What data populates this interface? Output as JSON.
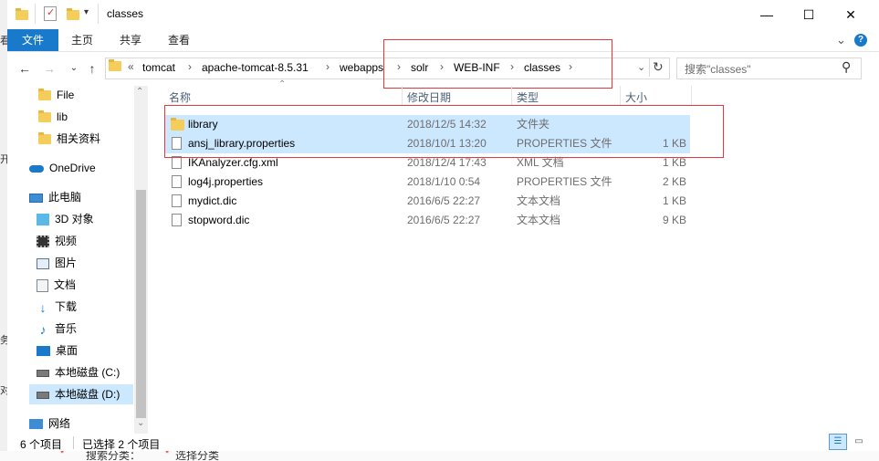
{
  "window": {
    "title": "classes",
    "minimize_glyph": "—",
    "maximize_glyph": "☐",
    "close_glyph": "✕"
  },
  "ribbon": {
    "tabs": [
      "文件",
      "主页",
      "共享",
      "查看"
    ],
    "expand_glyph": "⌄",
    "help_glyph": "?"
  },
  "nav_buttons": {
    "back": "←",
    "forward": "→",
    "recent": "⌄",
    "up": "↑"
  },
  "address": {
    "overflow": "«",
    "crumbs": [
      "tomcat",
      "apache-tomcat-8.5.31",
      "webapps",
      "solr",
      "WEB-INF",
      "classes"
    ],
    "separator": "›",
    "dropdown_glyph": "⌄",
    "refresh_glyph": "↻"
  },
  "search": {
    "placeholder": "搜索\"classes\"",
    "icon": "search-icon",
    "glyph": "⚲"
  },
  "sidebar": {
    "items": [
      {
        "label": "File",
        "icon": "folder-icon"
      },
      {
        "label": "lib",
        "icon": "folder-icon"
      },
      {
        "label": "相关资料",
        "icon": "folder-icon"
      },
      {
        "label": "OneDrive",
        "icon": "cloud-icon"
      },
      {
        "label": "此电脑",
        "icon": "computer-icon"
      },
      {
        "label": "3D 对象",
        "icon": "3d-objects-icon"
      },
      {
        "label": "视频",
        "icon": "video-icon"
      },
      {
        "label": "图片",
        "icon": "pictures-icon"
      },
      {
        "label": "文档",
        "icon": "documents-icon"
      },
      {
        "label": "下载",
        "icon": "download-icon"
      },
      {
        "label": "音乐",
        "icon": "music-icon"
      },
      {
        "label": "桌面",
        "icon": "desktop-icon"
      },
      {
        "label": "本地磁盘 (C:)",
        "icon": "drive-icon"
      },
      {
        "label": "本地磁盘 (D:)",
        "icon": "drive-icon"
      },
      {
        "label": "网络",
        "icon": "network-icon"
      }
    ],
    "scroll_up": "⌃",
    "scroll_down": "⌄"
  },
  "columns": {
    "name": "名称",
    "date": "修改日期",
    "type": "类型",
    "size": "大小",
    "sort_glyph": "⌃"
  },
  "files": [
    {
      "name": "library",
      "date": "2018/12/5 14:32",
      "type": "文件夹",
      "size": "",
      "kind": "folder",
      "selected": true
    },
    {
      "name": "ansj_library.properties",
      "date": "2018/10/1 13:20",
      "type": "PROPERTIES 文件",
      "size": "1 KB",
      "kind": "file",
      "selected": true
    },
    {
      "name": "IKAnalyzer.cfg.xml",
      "date": "2018/12/4 17:43",
      "type": "XML 文档",
      "size": "1 KB",
      "kind": "file",
      "selected": false
    },
    {
      "name": "log4j.properties",
      "date": "2018/1/10 0:54",
      "type": "PROPERTIES 文件",
      "size": "2 KB",
      "kind": "file",
      "selected": false
    },
    {
      "name": "mydict.dic",
      "date": "2016/6/5 22:27",
      "type": "文本文档",
      "size": "1 KB",
      "kind": "file",
      "selected": false
    },
    {
      "name": "stopword.dic",
      "date": "2016/6/5 22:27",
      "type": "文本文档",
      "size": "9 KB",
      "kind": "file",
      "selected": false
    }
  ],
  "status": {
    "count": "6 个项目",
    "selected": "已选择 2 个项目"
  },
  "background_fragments": {
    "bottom": [
      "*",
      "搜索分类：",
      "*",
      "选择分类"
    ],
    "left": [
      "看",
      "开",
      "务",
      "对"
    ]
  },
  "colors": {
    "accent": "#1979ca",
    "selection": "#cce8ff",
    "highlight_box": "#e0393e"
  }
}
